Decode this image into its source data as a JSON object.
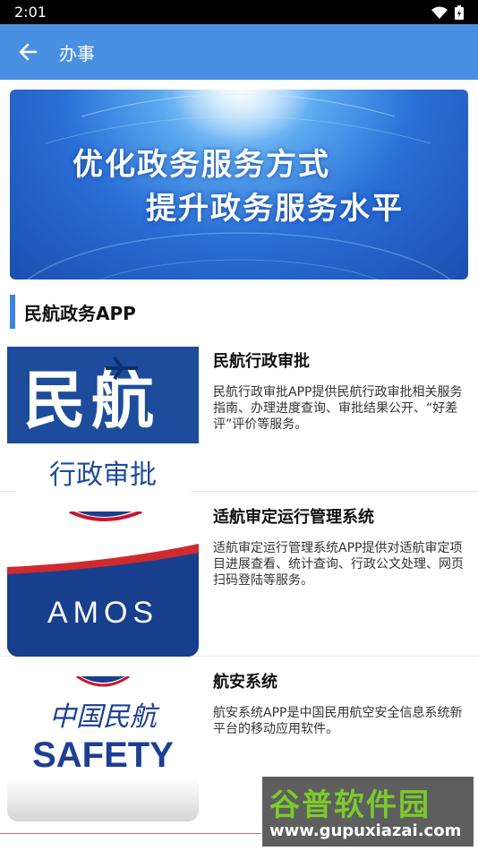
{
  "status_bar": {
    "time": "2:01"
  },
  "app_bar": {
    "title": "办事"
  },
  "banner": {
    "line1": "优化政务服务方式",
    "line2": "提升政务服务水平"
  },
  "section": {
    "title": "民航政务APP"
  },
  "items": [
    {
      "name": "民航行政审批",
      "description": "民航行政审批APP提供民航行政审批相关服务指南、办理进度查询、审批结果公开、“好差评”评价等服务。",
      "logo_text_top": "民航",
      "logo_text_bottom": "行政审批"
    },
    {
      "name": "适航审定运行管理系统",
      "description": "适航审定运行管理系统APP提供对适航审定项目进展查看、统计查询、行政公文处理、网页扫码登陆等服务。",
      "logo_text": "AMOS"
    },
    {
      "name": "航安系统",
      "description": "航安系统APP是中国民用航空安全信息系统新平台的移动应用软件。",
      "logo_text_top": "中国民航",
      "logo_text_bottom": "SAFETY"
    }
  ],
  "watermark": {
    "big": "谷普软件园",
    "small": "www.gupuxiazai.com"
  },
  "colors": {
    "app_bar": "#4a90e2",
    "accent": "#3d85e0"
  }
}
